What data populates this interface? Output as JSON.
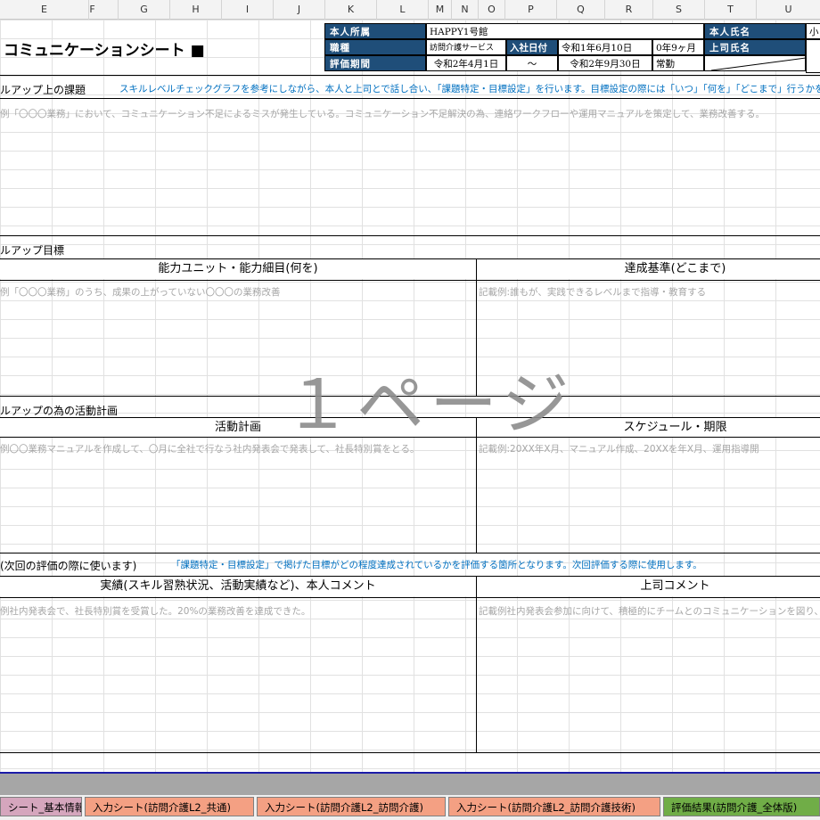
{
  "columns": [
    "E",
    "F",
    "G",
    "H",
    "I",
    "J",
    "K",
    "L",
    "M",
    "N",
    "O",
    "P",
    "Q",
    "R",
    "S",
    "T",
    "U"
  ],
  "title": "コミュニケーションシート ■",
  "info": {
    "affiliation_label": "本人所属",
    "affiliation_value": "HAPPY1号館",
    "name_label": "本人氏名",
    "name_value": "小",
    "job_label": "職種",
    "job_value": "訪問介護サービス",
    "join_label": "入社日付",
    "join_date": "令和1年6月10日",
    "tenure": "0年9ヶ月",
    "boss_label": "上司氏名",
    "period_label": "評価期間",
    "period_start": "令和2年4月1日",
    "period_sep": "〜",
    "period_end": "令和2年9月30日",
    "employment": "常勤"
  },
  "section1": {
    "label": "ルアップ上の課題",
    "note": "スキルレベルチェックグラフを参考にしながら、本人と上司とで話し合い、「課題特定・目標設定」を行います。目標設定の際には「いつ」「何を」「どこまで」行うかを明らかにし、具体的な",
    "example": "例「〇〇〇業務」において、コミュニケーション不足によるミスが発生している。コミュニケーション不足解決の為、連絡ワークフローや運用マニュアルを策定して、業務改善する。"
  },
  "section2": {
    "label": "ルアップ目標",
    "col_left": "能力ユニット・能力細目(何を)",
    "col_right": "達成基準(どこまで)",
    "example_left": "例「〇〇〇業務」のうち、成果の上がっていない〇〇〇の業務改善",
    "example_right": "記載例:誰もが、実践できるレベルまで指導・教育する"
  },
  "section3": {
    "label": "ルアップの為の活動計画",
    "col_left": "活動計画",
    "col_right": "スケジュール・期限",
    "example_left": "例〇〇業務マニュアルを作成して、〇月に全社で行なう社内発表会で発表して、社長特別賞をとる。",
    "example_right": "記載例:20XX年X月、マニュアル作成、20XXを年X月、運用指導開"
  },
  "section4": {
    "label": "(次回の評価の際に使います)",
    "note": "「課題特定・目標設定」で掲げた目標がどの程度達成されているかを評価する箇所となります。次回評価する際に使用します。",
    "col_left": "実績(スキル習熟状況、活動実績など)、本人コメント",
    "col_right": "上司コメント",
    "example_left": "例社内発表会で、社長特別賞を受賞した。20%の業務改善を達成できた。",
    "example_right": "記載例社内発表会参加に向けて、積極的にチームとのコミュニケーションを図り、"
  },
  "watermark": "１ページ",
  "tabs": [
    {
      "label": "シート_基本情報",
      "color": "#d5a6bd"
    },
    {
      "label": "入力シート(訪問介護L2_共通)",
      "color": "#f4a083"
    },
    {
      "label": "入力シート(訪問介護L2_訪問介護)",
      "color": "#f4a083"
    },
    {
      "label": "入力シート(訪問介護L2_訪問介護技術)",
      "color": "#f4a083"
    },
    {
      "label": "評価結果(訪問介護_全体版)",
      "color": "#70ad47"
    }
  ]
}
